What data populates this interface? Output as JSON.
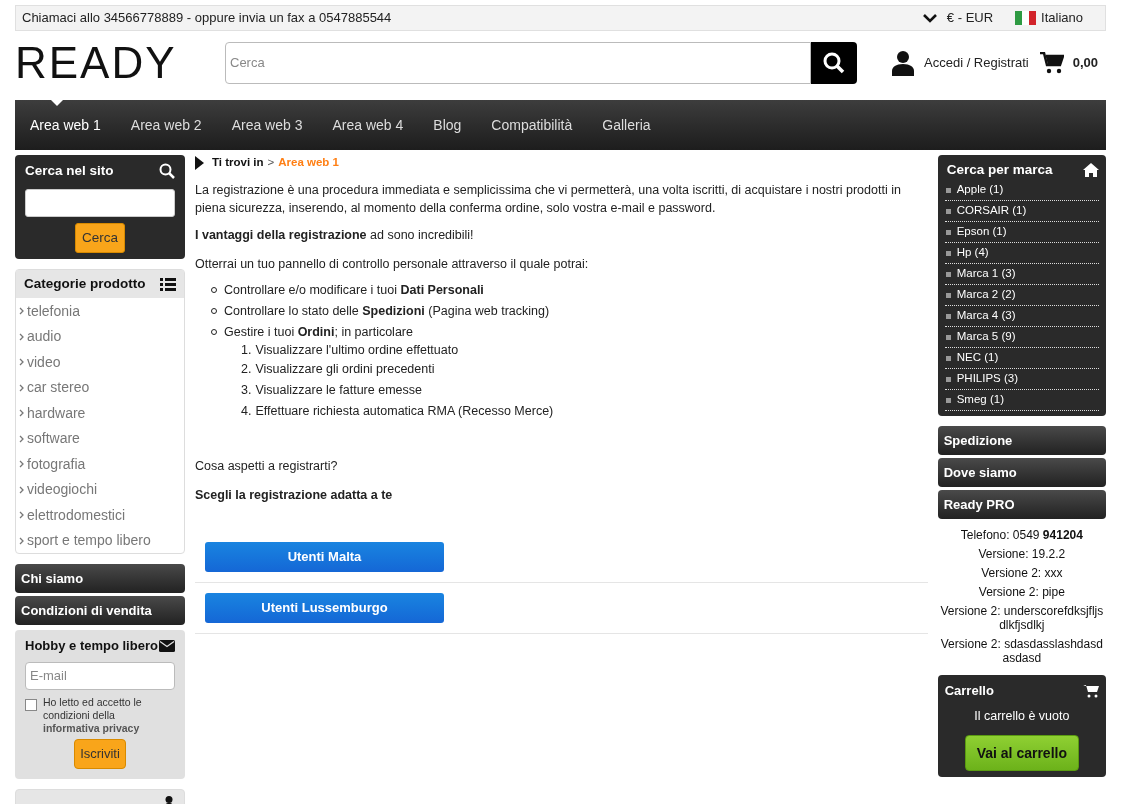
{
  "top_bar": {
    "contact": "Chiamaci allo 34566778889 - oppure invia un fax a 0547885544",
    "currency": "€ - EUR",
    "language": "Italiano"
  },
  "header": {
    "logo": "READY",
    "search_placeholder": "Cerca",
    "login": "Accedi / Registrati",
    "cart_total": "0,00"
  },
  "nav": [
    {
      "label": "Area web 1",
      "selected": true
    },
    {
      "label": "Area web 2",
      "selected": false
    },
    {
      "label": "Area web 3",
      "selected": false
    },
    {
      "label": "Area web 4",
      "selected": false
    },
    {
      "label": "Blog",
      "selected": false
    },
    {
      "label": "Compatibilità",
      "selected": false
    },
    {
      "label": "Galleria",
      "selected": false
    }
  ],
  "left": {
    "site_search": {
      "title": "Cerca nel sito",
      "button": "Cerca"
    },
    "categories": {
      "title": "Categorie prodotto",
      "items": [
        "telefonia",
        "audio",
        "video",
        "car stereo",
        "hardware",
        "software",
        "fotografia",
        "videogiochi",
        "elettrodomestici",
        "sport e tempo libero"
      ]
    },
    "links": [
      "Chi siamo",
      "Condizioni di vendita"
    ],
    "newsletter": {
      "title": "Hobby e tempo libero",
      "placeholder": "E-mail",
      "consent": "Ho letto ed accetto le condizioni della",
      "privacy_link": "informativa privacy",
      "checked": false,
      "button": "Iscriviti"
    }
  },
  "content": {
    "breadcrumb": {
      "label": "Ti trovi in",
      "separator": ">",
      "current": "Area web 1"
    },
    "intro": "La registrazione è una procedura immediata e semplicissima che vi permetterà, una volta iscritti, di acquistare i nostri prodotti in piena sicurezza, inserendo, al momento della conferma ordine, solo vostra e-mail e password.",
    "advantages": "**I vantaggi della registrazione** ad sono incredibili!",
    "panel_intro": "Otterrai un tuo pannello di controllo personale attraverso il quale potrai:",
    "features": [
      {
        "text": "Controllare e/o modificare i tuoi **Dati Personali**"
      },
      {
        "text": "Controllare lo stato delle **Spedizioni** (Pagina web tracking)"
      },
      {
        "text": "Gestire i tuoi **Ordini**; in particolare",
        "children": [
          {
            "number": "1.",
            "text": "Visualizzare l'ultimo ordine effettuato"
          },
          {
            "number": "2.",
            "text": "Visualizzare gli ordini precedenti"
          },
          {
            "number": "3.",
            "text": "Visualizzare le fatture emesse"
          },
          {
            "number": "4.",
            "text": "Effettuare richiesta automatica RMA (Recesso Merce)"
          }
        ]
      }
    ],
    "question": "Cosa aspetti a registrarti?",
    "choose": "Scegli la registrazione adatta a te",
    "buttons": [
      "Utenti Malta",
      "Utenti Lussemburgo"
    ]
  },
  "right": {
    "brands": {
      "title": "Cerca per marca",
      "items": [
        "Apple (1)",
        "CORSAIR (1)",
        "Epson (1)",
        "Hp (4)",
        "Marca 1 (3)",
        "Marca 2 (2)",
        "Marca 4 (3)",
        "Marca 5 (9)",
        "NEC (1)",
        "PHILIPS (3)",
        "Smeg (1)"
      ]
    },
    "links": [
      "Spedizione",
      "Dove siamo",
      "Ready PRO"
    ],
    "info": [
      "Telefono: 0549 **941204**",
      "Versione: 19.2.2",
      "Versione 2: xxx",
      "Versione 2: pipe",
      "Versione 2: underscorefdksjfljsdlkfjsdlkj",
      "Versione 2: sdasdasslashdasdasdasd"
    ],
    "cart": {
      "title": "Carrello",
      "empty": "Il carrello è vuoto",
      "button": "Vai al carrello"
    }
  }
}
